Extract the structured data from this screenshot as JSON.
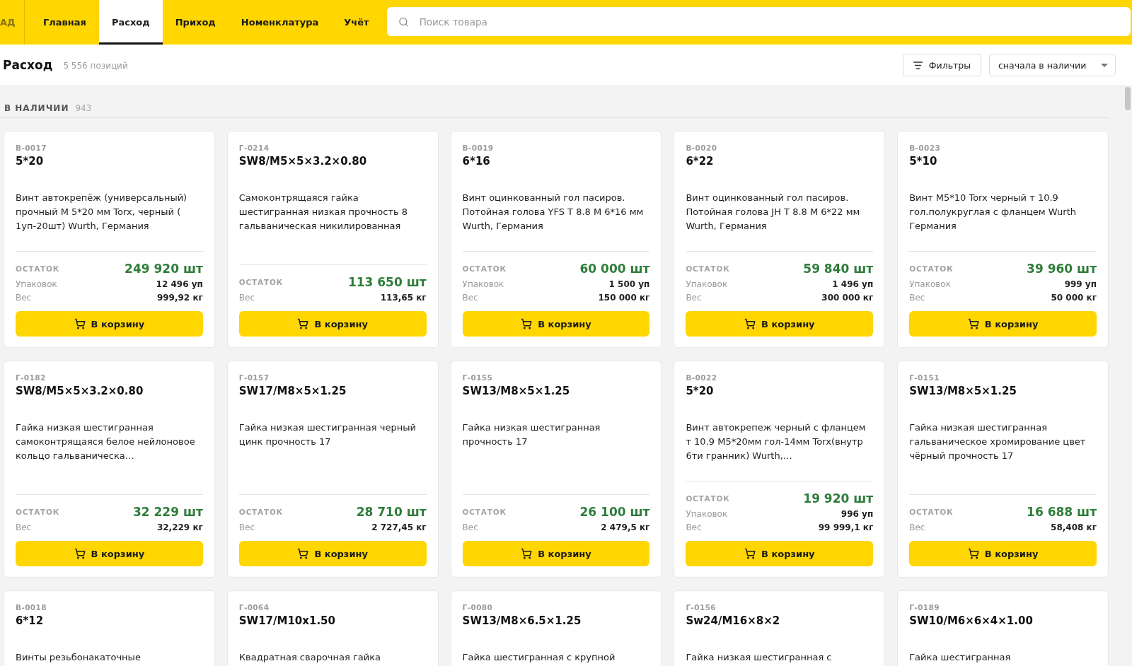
{
  "topbar": {
    "logo": "АД",
    "tabs": [
      {
        "label": "Главная",
        "selected": false
      },
      {
        "label": "Расход",
        "selected": true
      },
      {
        "label": "Приход",
        "selected": false
      },
      {
        "label": "Номенклатура",
        "selected": false
      },
      {
        "label": "Учёт",
        "selected": false
      }
    ],
    "search": {
      "placeholder": "Поиск товара"
    }
  },
  "page_header": {
    "title": "Расход",
    "count": "5 556 позиций",
    "filters_button": "Фильтры",
    "sort": {
      "value": "сначала в наличии"
    }
  },
  "section": {
    "title": "В НАЛИЧИИ",
    "count": "943"
  },
  "products": [
    {
      "code": "В-0017",
      "name": "5*20",
      "description": "Винт автокрепёж (универсальный) прочный М 5*20 мм Torx, черный ( 1уп-20шт) Wurth, Германия",
      "stock_label": "ОСТАТОК",
      "stock": "249 920 шт",
      "details": [
        {
          "label": "Упаковок",
          "value": "12 496 уп"
        },
        {
          "label": "Вес",
          "value": "999,92 кг"
        }
      ],
      "button": "В корзину"
    },
    {
      "code": "Г-0214",
      "name": "SW8/M5×5×3.2×0.80",
      "description": "Самоконтрящаяся гайка шестигранная низкая прочность 8 гальваническая никилированная",
      "stock_label": "ОСТАТОК",
      "stock": "113 650 шт",
      "details": [
        {
          "label": "Вес",
          "value": "113,65 кг"
        }
      ],
      "button": "В корзину"
    },
    {
      "code": "В-0019",
      "name": "6*16",
      "description": "Винт оцинкованный гол пасиров. Потойная голова YFS T 8.8 M 6*16 мм Wurth, Германия",
      "stock_label": "ОСТАТОК",
      "stock": "60 000 шт",
      "details": [
        {
          "label": "Упаковок",
          "value": "1 500 уп"
        },
        {
          "label": "Вес",
          "value": "150 000 кг"
        }
      ],
      "button": "В корзину"
    },
    {
      "code": "В-0020",
      "name": "6*22",
      "description": "Винт оцинкованный гол пасиров. Потойная голова JH T 8.8 M 6*22 мм Wurth, Германия",
      "stock_label": "ОСТАТОК",
      "stock": "59 840 шт",
      "details": [
        {
          "label": "Упаковок",
          "value": "1 496 уп"
        },
        {
          "label": "Вес",
          "value": "300 000 кг"
        }
      ],
      "button": "В корзину"
    },
    {
      "code": "В-0023",
      "name": "5*10",
      "description": "Винт M5*10 Torx черный т 10.9 гол.полукруглая с фланцем Wurth Германия",
      "stock_label": "ОСТАТОК",
      "stock": "39 960 шт",
      "details": [
        {
          "label": "Упаковок",
          "value": "999 уп"
        },
        {
          "label": "Вес",
          "value": "50 000 кг"
        }
      ],
      "button": "В корзину"
    },
    {
      "code": "Г-0182",
      "name": "SW8/M5×5×3.2×0.80",
      "description": "Гайка низкая шестигранная самоконтрящаяся белое нейлоновое кольцо гальваническа…",
      "stock_label": "ОСТАТОК",
      "stock": "32 229 шт",
      "details": [
        {
          "label": "Вес",
          "value": "32,229 кг"
        }
      ],
      "button": "В корзину"
    },
    {
      "code": "Г-0157",
      "name": "SW17/M8×5×1.25",
      "description": "Гайка низкая шестигранная черный цинк прочность 17",
      "stock_label": "ОСТАТОК",
      "stock": "28 710 шт",
      "details": [
        {
          "label": "Вес",
          "value": "2 727,45 кг"
        }
      ],
      "button": "В корзину"
    },
    {
      "code": "Г-0155",
      "name": "SW13/M8×5×1.25",
      "description": "Гайка низкая шестигранная прочность 17",
      "stock_label": "ОСТАТОК",
      "stock": "26 100 шт",
      "details": [
        {
          "label": "Вес",
          "value": "2 479,5 кг"
        }
      ],
      "button": "В корзину"
    },
    {
      "code": "В-0022",
      "name": "5*20",
      "description": "Винт автокрепеж черный с фланцем т 10.9 M5*20мм гол-14мм Torx(внутр 6ти гранник) Wurth,…",
      "stock_label": "ОСТАТОК",
      "stock": "19 920 шт",
      "details": [
        {
          "label": "Упаковок",
          "value": "996 уп"
        },
        {
          "label": "Вес",
          "value": "99 999,1 кг"
        }
      ],
      "button": "В корзину"
    },
    {
      "code": "Г-0151",
      "name": "SW13/M8×5×1.25",
      "description": "Гайка низкая шестигранная гальваническое хромирование цвет чёрный прочность 17",
      "stock_label": "ОСТАТОК",
      "stock": "16 688 шт",
      "details": [
        {
          "label": "Вес",
          "value": "58,408 кг"
        }
      ],
      "button": "В корзину"
    },
    {
      "code": "В-0018",
      "name": "6*12",
      "description": "Винты резьбонакаточные"
    },
    {
      "code": "Г-0064",
      "name": "SW17/M10x1.50",
      "description": "Квадратная сварочная гайка"
    },
    {
      "code": "Г-0080",
      "name": "SW13/M8×6.5×1.25",
      "description": "Гайка шестигранная с крупной"
    },
    {
      "code": "Г-0156",
      "name": "Sw24/M16×8×2",
      "description": "Гайка низкая шестигранная с"
    },
    {
      "code": "Г-0189",
      "name": "SW10/M6×6×4×1.00",
      "description": "Гайка шестигранная"
    }
  ]
}
